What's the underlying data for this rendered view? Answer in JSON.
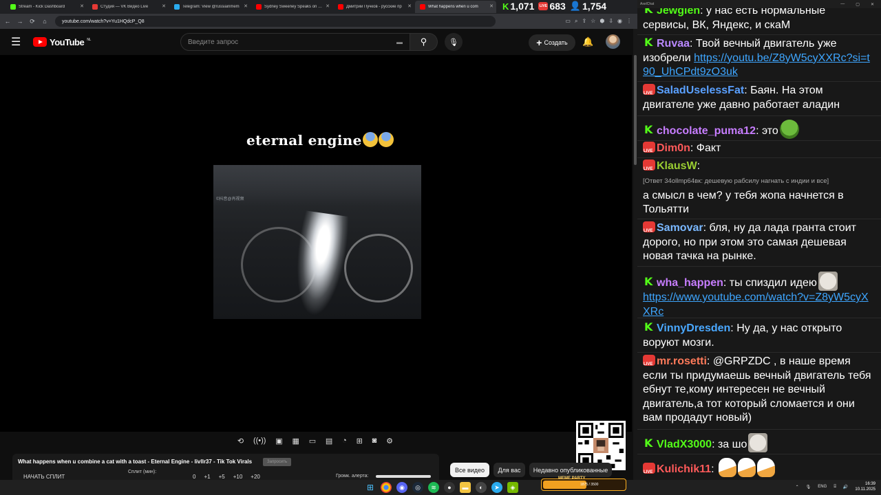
{
  "browser": {
    "tabs": [
      {
        "title": "Stream - Kick Dashboard",
        "color": "#53fc18"
      },
      {
        "title": "Студия — VK Видео Live",
        "color": "#e53935"
      },
      {
        "title": "Telegram: View @russiainmem",
        "color": "#2aabee"
      },
      {
        "title": "Sydney Sweeney Speaks on The",
        "color": "#ff0000"
      },
      {
        "title": "Дмитрий Пучков - русские пр",
        "color": "#ff0000"
      },
      {
        "title": "What happens when u com",
        "color": "#ff0000"
      }
    ],
    "url": "youtube.com/watch?v=Yu1HQdcP_Q8"
  },
  "stats": {
    "kick_viewers": "1,071",
    "vk_viewers": "683",
    "total_viewers": "1,754"
  },
  "youtube": {
    "logo_text": "YouTube",
    "region": "NL",
    "search_placeholder": "Введите запрос",
    "create_label": "Создать",
    "video_caption": "eternal engine",
    "video_overlay_text": "©抖音@肖视频",
    "video_title": "What happens when u combine a cat with a toast - Eternal Engine - livllr37 - Tik Tok Virals",
    "tag_label": "Запросить",
    "split_button": "НАЧАТЬ СПЛИТ",
    "split_label": "Сплит (мин):",
    "split_values": [
      "0",
      "+1",
      "+5",
      "+10",
      "+20"
    ],
    "volume_label": "Громк. алерта:",
    "chips": [
      "Все видео",
      "Для вас",
      "Недавно опубликованные"
    ]
  },
  "chat": {
    "window_title": "AxelChat",
    "messages": [
      {
        "platform": "kick",
        "user": "Jewglen",
        "color": "#53fc18",
        "text": "у нас есть нормальные сервисы, ВК, Яндекс, и скаМ"
      },
      {
        "platform": "kick",
        "user": "Ruvaa",
        "color": "#b988ff",
        "text": "Твой вечный двигатель уже изобрели ",
        "link": "https://youtu.be/Z8yW5cyXXRc?si=t90_UhCPdt9zO3uk"
      },
      {
        "platform": "vk",
        "user": "SaladUselessFat",
        "color": "#5aa0ff",
        "text": "Баян. На этом двигателе уже давно работает аладин"
      },
      {
        "platform": "kick",
        "user": "chocolate_puma12",
        "color": "#c77dff",
        "text": "это",
        "emote": "pepe"
      },
      {
        "platform": "vk",
        "user": "Dim0n",
        "color": "#ff5a5a",
        "text": "Факт"
      },
      {
        "platform": "vk",
        "user": "KlausW",
        "color": "#9acd32",
        "reply": "[Ответ 34ollmp64вк: дешевую рабсилу нагнать с индии и все]",
        "text": "а смысл в чем? у тебя жопа начнется в Тольятти"
      },
      {
        "platform": "vk",
        "user": "Samovar",
        "color": "#7ab8ff",
        "text": "бля, ну да лада гранта стоит дорого, но при этом это самая дешевая новая тачка на рынке."
      },
      {
        "platform": "kick",
        "user": "wha_happen",
        "color": "#c77dff",
        "text": "ты спиздил идею",
        "emote": "cat",
        "link": "https://www.youtube.com/watch?v=Z8yW5cyXXRc"
      },
      {
        "platform": "kick",
        "user": "VinnyDresden",
        "color": "#4aa8ff",
        "text": "Ну да, у нас открыто воруют мозги."
      },
      {
        "platform": "vk",
        "user": "mr.rosetti",
        "color": "#ff7a5a",
        "text": "@GRPZDC , в наше время если ты придумаешь вечный двигатель тебя ебнут те,кому интересен не вечный двигатель,а тот который сломается и они вам продадут новый)"
      },
      {
        "platform": "kick",
        "user": "VladX3000",
        "color": "#53fc18",
        "text": "за шо",
        "emote": "cat"
      },
      {
        "platform": "vk",
        "user": "Kulichik11",
        "color": "#ff5a5a",
        "text": "",
        "emote": "goose"
      }
    ]
  },
  "goal": {
    "title": "МЕМЕ PARTY",
    "count": "1875 / 3500",
    "progress": 0.536
  },
  "taskbar": {
    "lang": "ENG",
    "time": "16:39",
    "date": "10.11.2025"
  }
}
